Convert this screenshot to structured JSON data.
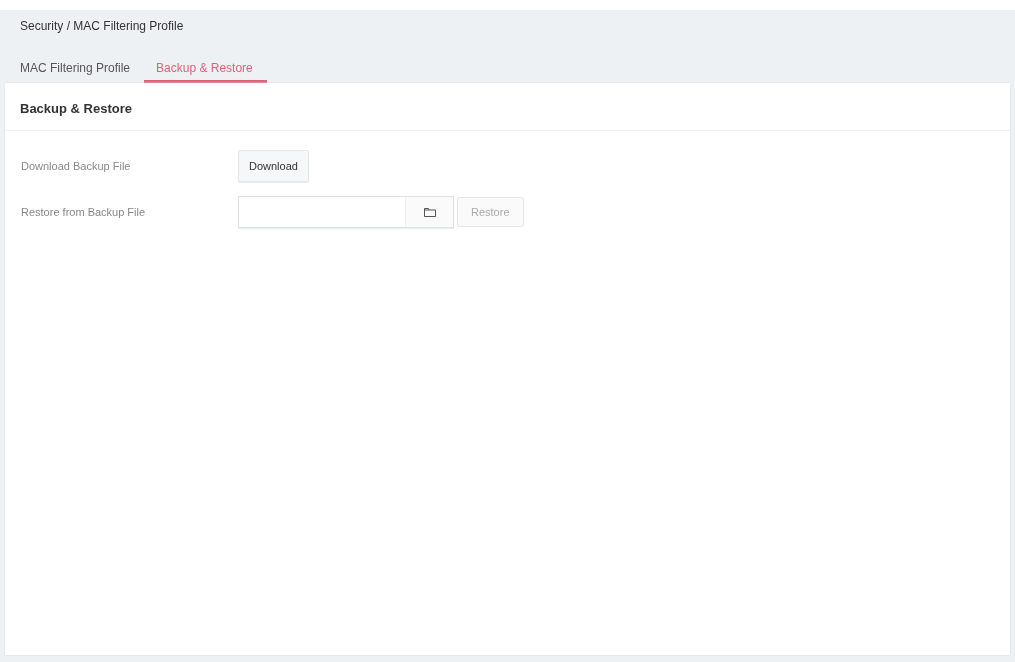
{
  "breadcrumb": "Security / MAC Filtering Profile",
  "tabs": [
    {
      "label": "MAC Filtering Profile",
      "selected": false
    },
    {
      "label": "Backup & Restore",
      "selected": true
    }
  ],
  "panel": {
    "title": "Backup & Restore",
    "rows": [
      {
        "kind": "button",
        "label": "Download Backup File",
        "button": {
          "label": "Download",
          "disabled": false
        }
      },
      {
        "kind": "file",
        "label": "Restore from Backup File",
        "button": {
          "label": "Restore",
          "disabled": true
        }
      }
    ]
  }
}
